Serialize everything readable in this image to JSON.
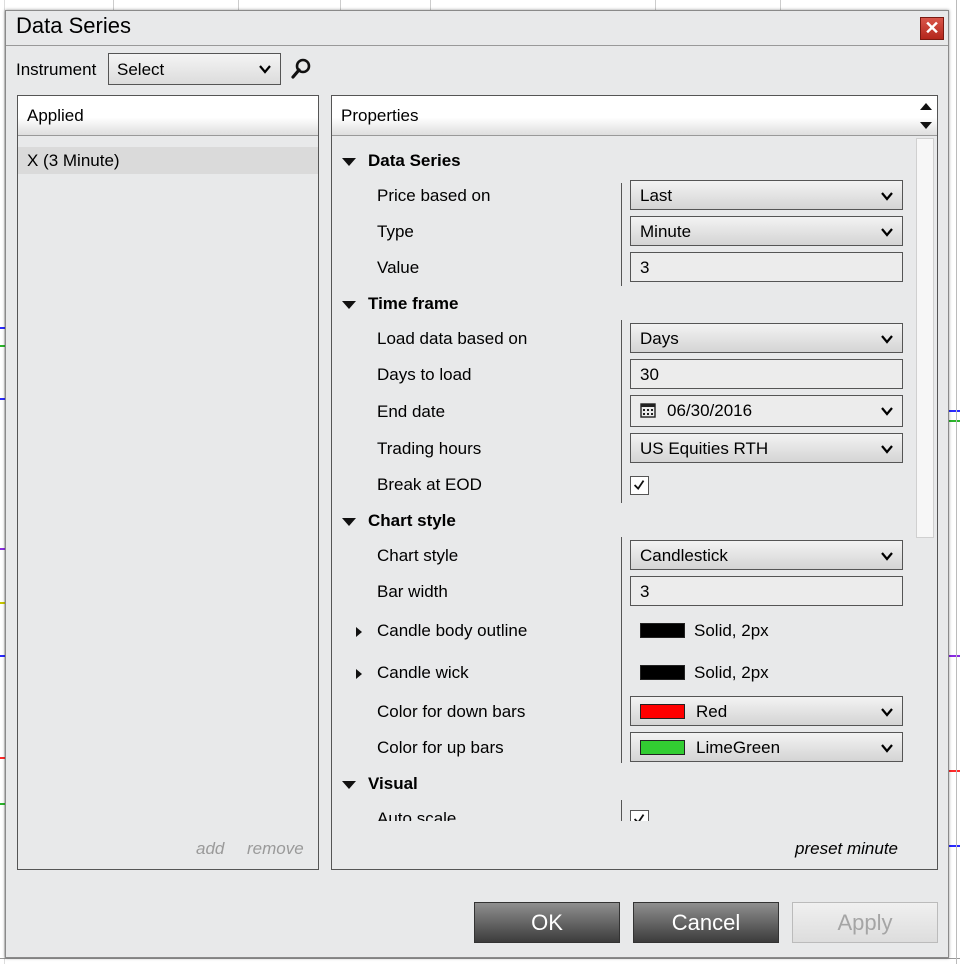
{
  "dialog": {
    "title": "Data Series",
    "close_glyph": "✕"
  },
  "instrument": {
    "label": "Instrument",
    "value": "Select"
  },
  "applied": {
    "header": "Applied",
    "items": [
      "X (3 Minute)"
    ],
    "add_label": "add",
    "remove_label": "remove"
  },
  "properties": {
    "header": "Properties",
    "preset_label": "preset minute",
    "data_series": {
      "title": "Data Series",
      "price_based_on": {
        "label": "Price based on",
        "value": "Last"
      },
      "type": {
        "label": "Type",
        "value": "Minute"
      },
      "value": {
        "label": "Value",
        "value": "3"
      }
    },
    "time_frame": {
      "title": "Time frame",
      "load_data_based_on": {
        "label": "Load data based on",
        "value": "Days"
      },
      "days_to_load": {
        "label": "Days to load",
        "value": "30"
      },
      "end_date": {
        "label": "End date",
        "value": "06/30/2016"
      },
      "trading_hours": {
        "label": "Trading hours",
        "value": "US Equities RTH"
      },
      "break_at_eod": {
        "label": "Break at EOD",
        "checked": true
      }
    },
    "chart_style": {
      "title": "Chart style",
      "chart_style": {
        "label": "Chart style",
        "value": "Candlestick"
      },
      "bar_width": {
        "label": "Bar width",
        "value": "3"
      },
      "candle_body_outline": {
        "label": "Candle body outline",
        "value": "Solid, 2px",
        "color": "#000000"
      },
      "candle_wick": {
        "label": "Candle wick",
        "value": "Solid, 2px",
        "color": "#000000"
      },
      "color_down_bars": {
        "label": "Color for down bars",
        "value": "Red",
        "color": "#ff0000"
      },
      "color_up_bars": {
        "label": "Color for up bars",
        "value": "LimeGreen",
        "color": "#32cd32"
      }
    },
    "visual": {
      "title": "Visual",
      "auto_scale": {
        "label": "Auto scale",
        "checked": true
      }
    }
  },
  "buttons": {
    "ok": "OK",
    "cancel": "Cancel",
    "apply": "Apply"
  }
}
